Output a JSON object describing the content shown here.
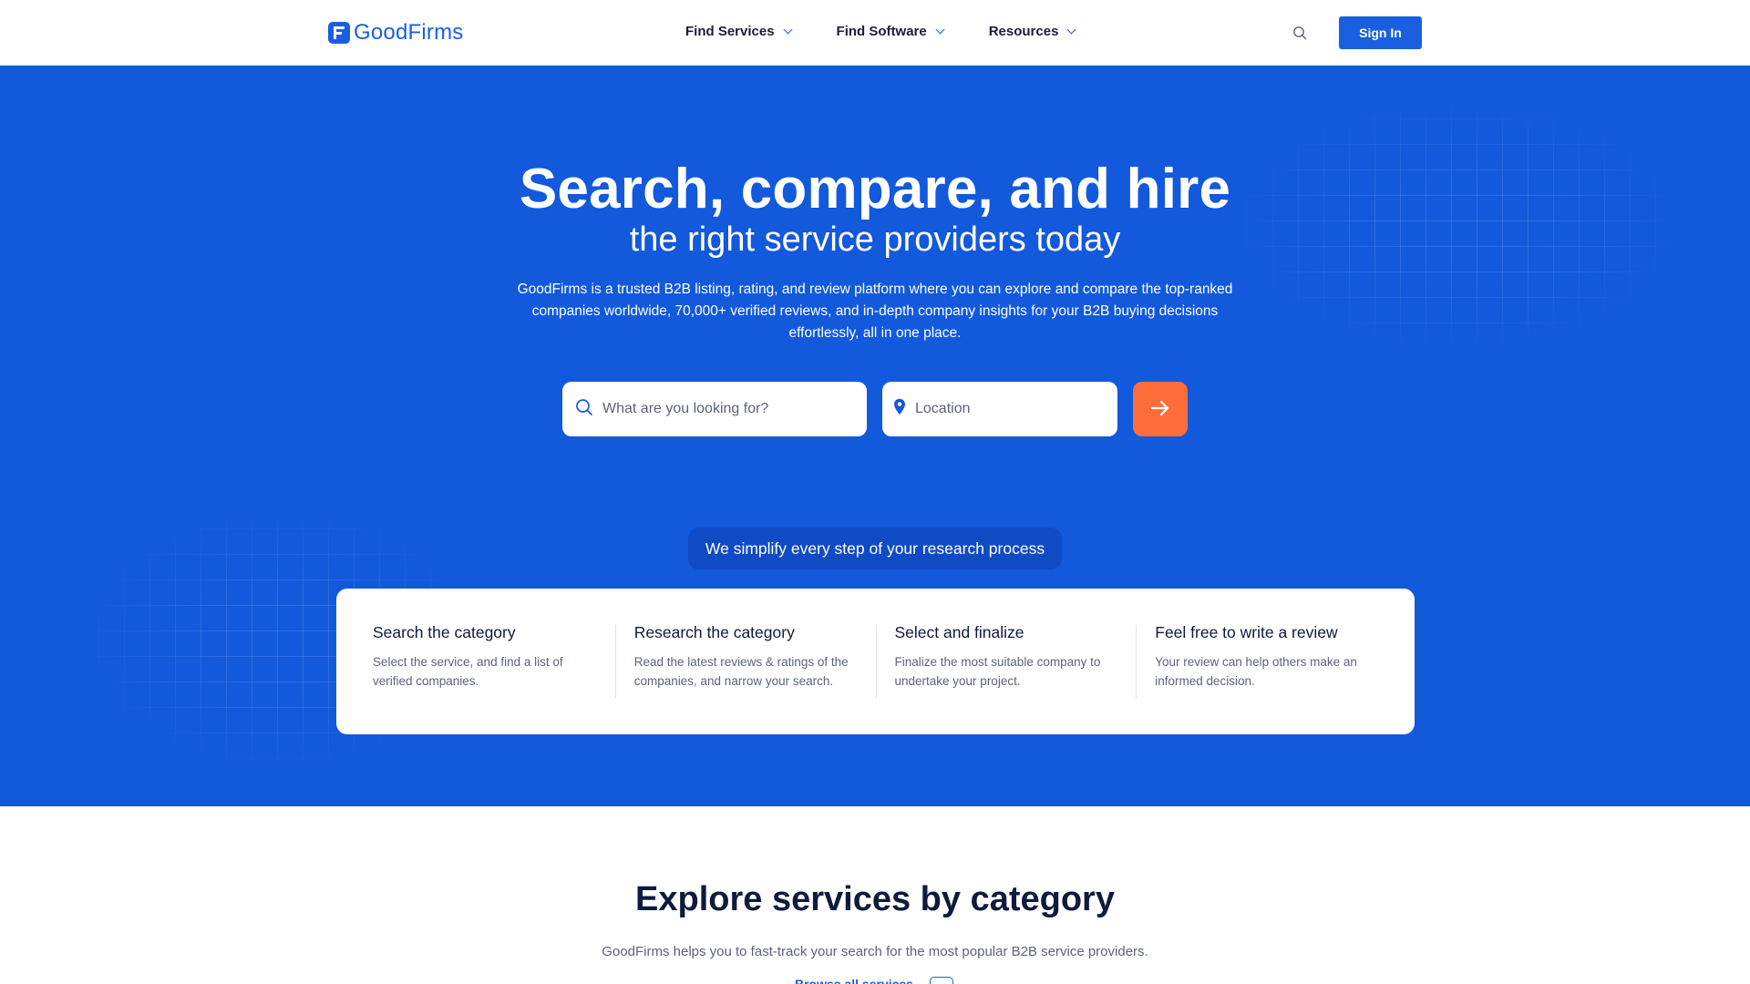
{
  "header": {
    "logo_text": "GoodFirms",
    "nav": [
      {
        "label": "Find Services"
      },
      {
        "label": "Find Software"
      },
      {
        "label": "Resources"
      }
    ],
    "sign_in_label": "Sign In"
  },
  "hero": {
    "title": "Search, compare, and hire",
    "subtitle": "the right service providers today",
    "description": "GoodFirms is a trusted B2B listing, rating, and review platform where you can explore and compare the top-ranked companies worldwide, 70,000+ verified reviews, and in-depth company insights for your B2B buying decisions effortlessly, all in one place.",
    "search_placeholder": "What are you looking for?",
    "location_placeholder": "Location",
    "simplify_text": "We simplify every step of your research process",
    "steps": [
      {
        "title": "Search the category",
        "desc": "Select the service, and find a list of verified companies."
      },
      {
        "title": "Research the category",
        "desc": "Read the latest reviews & ratings of the companies, and narrow your search."
      },
      {
        "title": "Select and finalize",
        "desc": "Finalize the most suitable company to undertake your project."
      },
      {
        "title": "Feel free to write a review",
        "desc": "Your review can help others make an informed decision."
      }
    ]
  },
  "explore": {
    "title": "Explore services by category",
    "description": "GoodFirms helps you to fast-track your search for the most popular B2B service providers.",
    "browse_label": "Browse all services"
  },
  "colors": {
    "brand_blue": "#1a5fe0",
    "hero_blue": "#1259dc",
    "accent_orange": "#ff6d3a"
  }
}
